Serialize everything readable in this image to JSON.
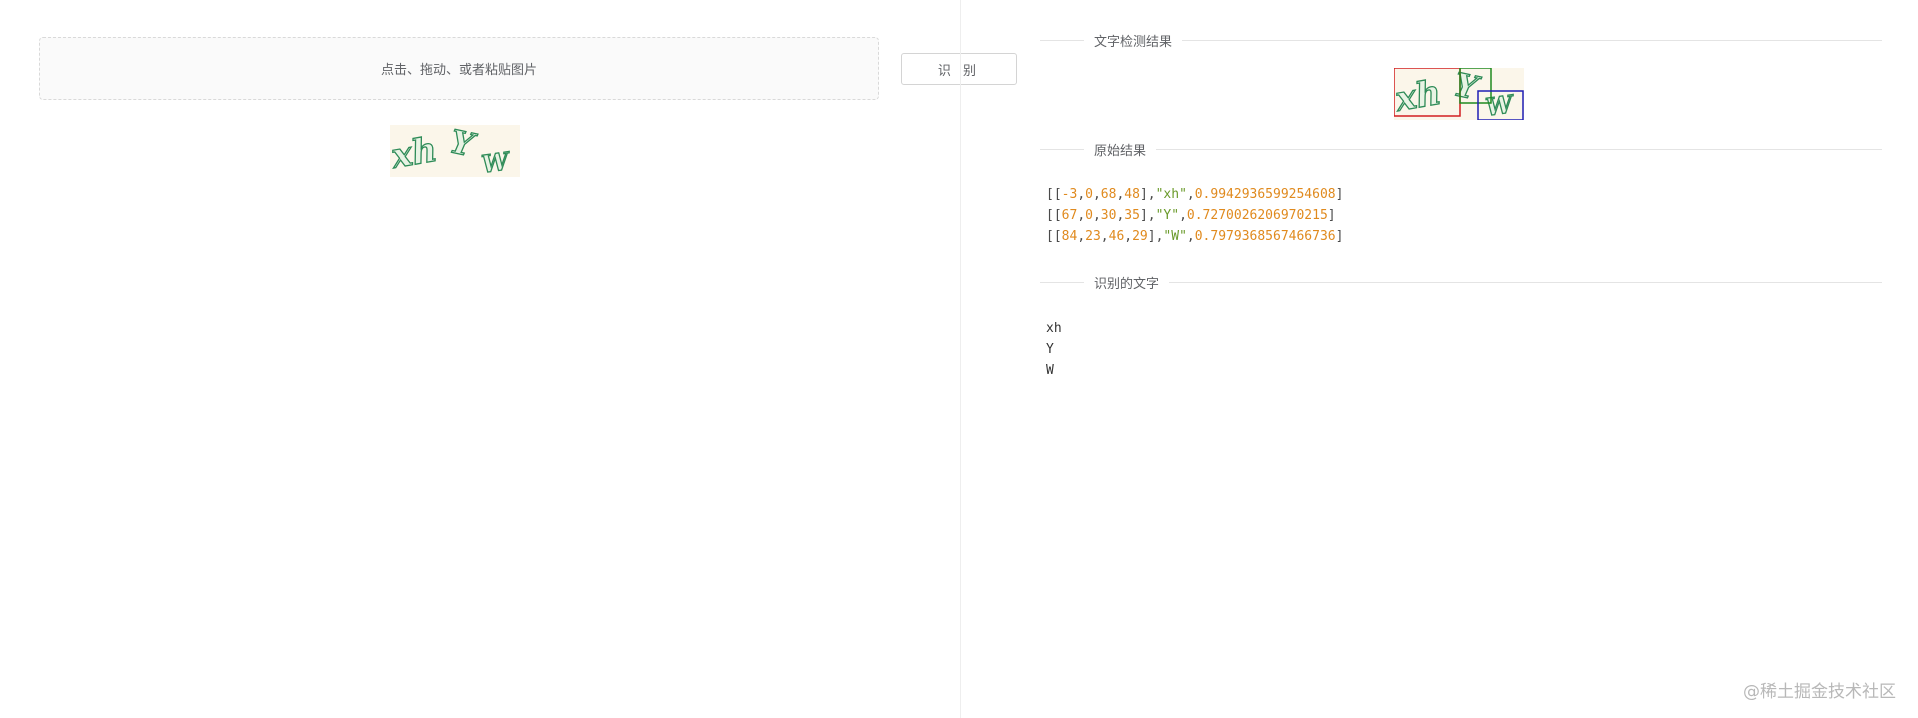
{
  "upload": {
    "hint": "点击、拖动、或者粘贴图片"
  },
  "toolbar": {
    "recognize_label": "识 别"
  },
  "captcha": {
    "text_parts": [
      "xh",
      "Y",
      "W"
    ],
    "text_color": "#2e8b57",
    "background": "#fbf6ea"
  },
  "sections": {
    "detection_title": "文字检测结果",
    "raw_title": "原始结果",
    "recognized_title": "识别的文字"
  },
  "detection": {
    "box_colors": [
      "#d21f1f",
      "#1f8a1f",
      "#1f1fb4"
    ]
  },
  "raw_results": [
    {
      "box": [
        "-3",
        "0",
        "68",
        "48"
      ],
      "text": "\"xh\"",
      "score": "0.9942936599254608"
    },
    {
      "box": [
        "67",
        "0",
        "30",
        "35"
      ],
      "text": "\"Y\"",
      "score": "0.7270026206970215"
    },
    {
      "box": [
        "84",
        "23",
        "46",
        "29"
      ],
      "text": "\"W\"",
      "score": "0.7979368567466736"
    }
  ],
  "recognized": {
    "lines": [
      "xh",
      "Y",
      "W"
    ]
  },
  "watermark": {
    "text": "@稀土掘金技术社区"
  },
  "colors": {
    "number": "#e08a1e",
    "string": "#6a9a2a",
    "divider": "#e4e4e4"
  }
}
